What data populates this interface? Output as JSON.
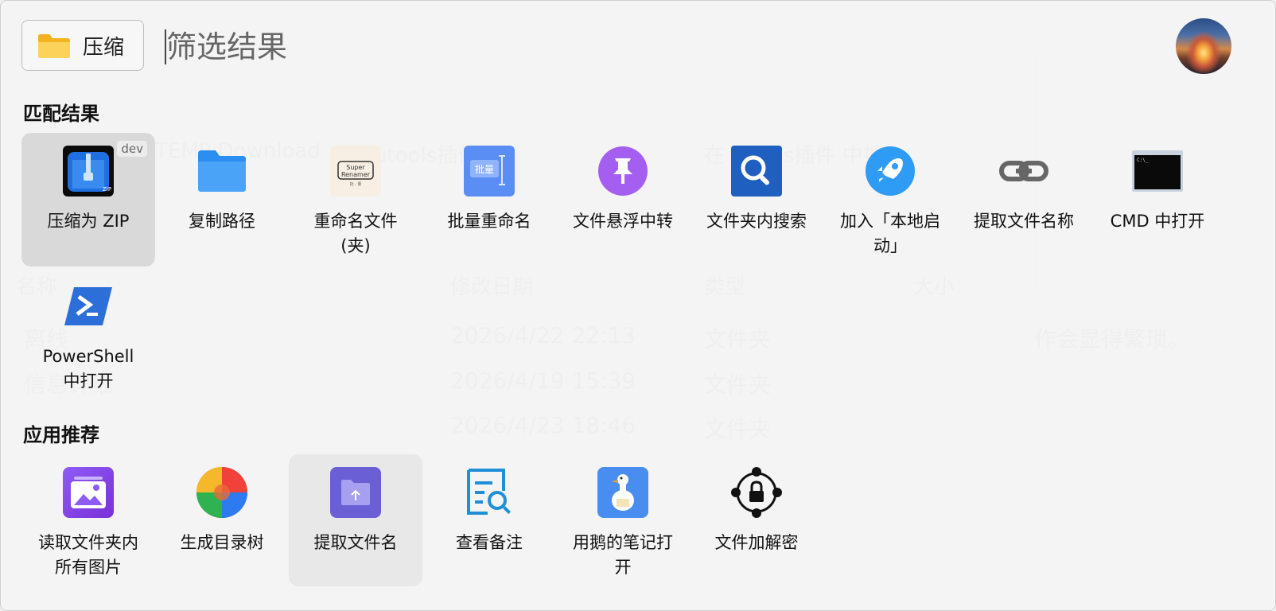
{
  "folder_tag": {
    "label": "压缩",
    "icon": "folder-icon"
  },
  "search": {
    "placeholder": "筛选结果",
    "value": ""
  },
  "avatar": {
    "icon": "user-avatar"
  },
  "sections": {
    "match_title": "匹配结果",
    "recommend_title": "应用推荐"
  },
  "match_items": [
    {
      "name": "压缩为 ZIP",
      "badge": "dev",
      "icon": "zip-archive-icon",
      "selected": true
    },
    {
      "name": "复制路径",
      "icon": "folder-icon"
    },
    {
      "name": "重命名文件(夹)",
      "icon": "super-renamer-icon"
    },
    {
      "name": "批量重命名",
      "icon": "batch-rename-icon"
    },
    {
      "name": "文件悬浮中转",
      "icon": "pin-icon"
    },
    {
      "name": "文件夹内搜索",
      "icon": "search-icon"
    },
    {
      "name": "加入「本地启动」",
      "icon": "rocket-icon"
    },
    {
      "name": "提取文件名称",
      "icon": "link-icon"
    },
    {
      "name": "CMD 中打开",
      "icon": "cmd-icon"
    },
    {
      "name": "PowerShell 中打开",
      "icon": "powershell-icon"
    }
  ],
  "recommend_items": [
    {
      "name": "读取文件夹内所有图片",
      "icon": "image-gallery-icon"
    },
    {
      "name": "生成目录树",
      "icon": "directory-tree-icon"
    },
    {
      "name": "提取文件名",
      "icon": "folder-extract-icon"
    },
    {
      "name": "查看备注",
      "icon": "note-search-icon"
    },
    {
      "name": "用鹅的笔记打开",
      "icon": "goose-note-icon"
    },
    {
      "name": "文件加解密",
      "icon": "encrypt-lock-icon"
    }
  ],
  "background": {
    "paths": [
      "TEMP Download",
      "utools插件",
      "在 utools插件 中搜"
    ],
    "columns": [
      "名称",
      "修改日期",
      "类型",
      "大小"
    ],
    "rows": [
      {
        "name": "离线",
        "date": "2026/4/22  22:13",
        "type": "文件夹"
      },
      {
        "name": "信息详细",
        "date": "2026/4/19  15:39",
        "type": "文件夹"
      },
      {
        "name": "",
        "date": "2026/4/23  18:46",
        "type": "文件夹"
      }
    ],
    "side_text": "作会显得繁琐。"
  }
}
